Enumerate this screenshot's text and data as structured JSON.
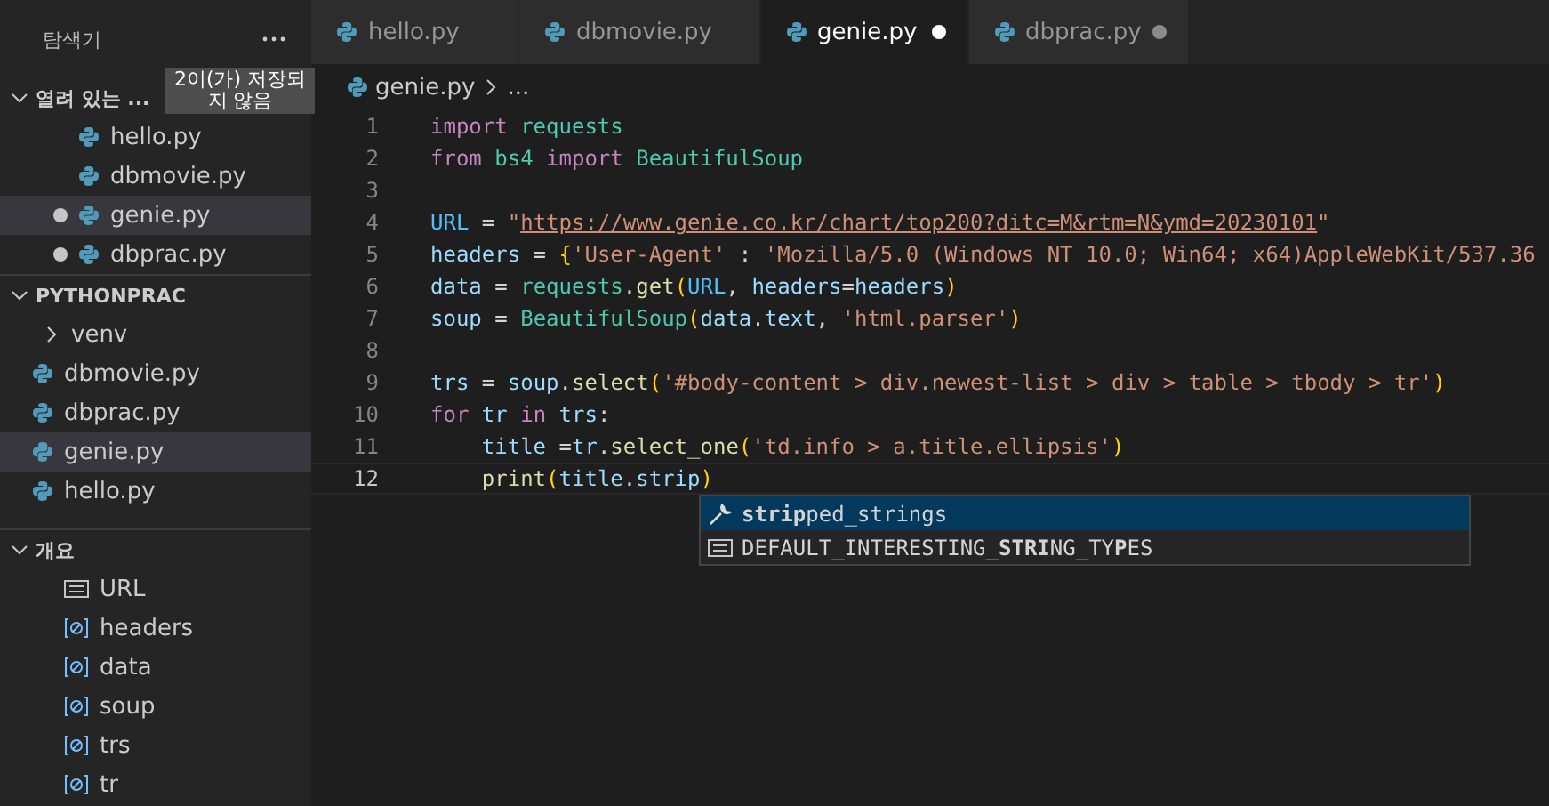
{
  "sidebar": {
    "title": "탐색기",
    "open_editors": {
      "title": "열려 있는 ...",
      "expanded": true,
      "tooltip": "2이(가) 저장되지 않음",
      "items": [
        {
          "name": "hello.py",
          "unsaved": false,
          "selected": false
        },
        {
          "name": "dbmovie.py",
          "unsaved": false,
          "selected": false
        },
        {
          "name": "genie.py",
          "unsaved": true,
          "selected": true
        },
        {
          "name": "dbprac.py",
          "unsaved": true,
          "selected": false
        }
      ]
    },
    "project": {
      "title": "PYTHONPRAC",
      "expanded": true,
      "items": [
        {
          "kind": "folder",
          "name": "venv",
          "selected": false
        },
        {
          "kind": "file",
          "name": "dbmovie.py",
          "selected": false
        },
        {
          "kind": "file",
          "name": "dbprac.py",
          "selected": false
        },
        {
          "kind": "file",
          "name": "genie.py",
          "selected": true
        },
        {
          "kind": "file",
          "name": "hello.py",
          "selected": false
        }
      ]
    },
    "outline": {
      "title": "개요",
      "expanded": true,
      "items": [
        {
          "kind": "constant",
          "name": "URL"
        },
        {
          "kind": "variable",
          "name": "headers"
        },
        {
          "kind": "variable",
          "name": "data"
        },
        {
          "kind": "variable",
          "name": "soup"
        },
        {
          "kind": "variable",
          "name": "trs"
        },
        {
          "kind": "variable",
          "name": "tr"
        }
      ]
    }
  },
  "tabs": [
    {
      "label": "hello.py",
      "selected": false,
      "unsaved": false
    },
    {
      "label": "dbmovie.py",
      "selected": false,
      "unsaved": false
    },
    {
      "label": "genie.py",
      "selected": true,
      "unsaved": true
    },
    {
      "label": "dbprac.py",
      "selected": false,
      "unsaved": true
    }
  ],
  "breadcrumb": {
    "file": "genie.py",
    "more": "..."
  },
  "code": [
    {
      "number": "1",
      "current": false,
      "tokens": [
        {
          "text": "import ",
          "kind": "keyword"
        },
        {
          "text": "requests",
          "kind": "module"
        }
      ]
    },
    {
      "number": "2",
      "current": false,
      "tokens": [
        {
          "text": "from ",
          "kind": "keyword"
        },
        {
          "text": "bs4 ",
          "kind": "module"
        },
        {
          "text": "import ",
          "kind": "keyword"
        },
        {
          "text": "BeautifulSoup",
          "kind": "module"
        }
      ]
    },
    {
      "number": "3",
      "current": false
    },
    {
      "number": "4",
      "current": false,
      "tokens": [
        {
          "text": "URL",
          "kind": "constant"
        },
        {
          "text": " = ",
          "kind": "plain"
        },
        {
          "text": "\"",
          "kind": "string"
        },
        {
          "text": "https://www.genie.co.kr/chart/top200?ditc=M&rtm=N&ymd=20230101",
          "kind": "link"
        },
        {
          "text": "\"",
          "kind": "string"
        }
      ]
    },
    {
      "number": "5",
      "current": false,
      "tokens": [
        {
          "text": "headers",
          "kind": "variable"
        },
        {
          "text": " = ",
          "kind": "plain"
        },
        {
          "text": "{",
          "kind": "bracket"
        },
        {
          "text": "'User-Agent'",
          "kind": "string"
        },
        {
          "text": " : ",
          "kind": "plain"
        },
        {
          "text": "'Mozilla/5.0 (Windows NT 10.0; Win64; x64)AppleWebKit/537.36",
          "kind": "string"
        }
      ]
    },
    {
      "number": "6",
      "current": false,
      "tokens": [
        {
          "text": "data",
          "kind": "variable"
        },
        {
          "text": " = ",
          "kind": "plain"
        },
        {
          "text": "requests",
          "kind": "module"
        },
        {
          "text": ".",
          "kind": "plain"
        },
        {
          "text": "get",
          "kind": "function"
        },
        {
          "text": "(",
          "kind": "bracket"
        },
        {
          "text": "URL",
          "kind": "constant"
        },
        {
          "text": ", ",
          "kind": "plain"
        },
        {
          "text": "headers",
          "kind": "variable"
        },
        {
          "text": "=",
          "kind": "plain"
        },
        {
          "text": "headers",
          "kind": "variable"
        },
        {
          "text": ")",
          "kind": "bracket"
        }
      ]
    },
    {
      "number": "7",
      "current": false,
      "tokens": [
        {
          "text": "soup",
          "kind": "variable"
        },
        {
          "text": " = ",
          "kind": "plain"
        },
        {
          "text": "BeautifulSoup",
          "kind": "module"
        },
        {
          "text": "(",
          "kind": "bracket"
        },
        {
          "text": "data",
          "kind": "variable"
        },
        {
          "text": ".",
          "kind": "plain"
        },
        {
          "text": "text",
          "kind": "variable"
        },
        {
          "text": ", ",
          "kind": "plain"
        },
        {
          "text": "'html.parser'",
          "kind": "string"
        },
        {
          "text": ")",
          "kind": "bracket"
        }
      ]
    },
    {
      "number": "8",
      "current": false
    },
    {
      "number": "9",
      "current": false,
      "tokens": [
        {
          "text": "trs",
          "kind": "variable"
        },
        {
          "text": " = ",
          "kind": "plain"
        },
        {
          "text": "soup",
          "kind": "variable"
        },
        {
          "text": ".",
          "kind": "plain"
        },
        {
          "text": "select",
          "kind": "function"
        },
        {
          "text": "(",
          "kind": "bracket"
        },
        {
          "text": "'#body-content > div.newest-list > div > table > tbody > tr'",
          "kind": "string"
        },
        {
          "text": ")",
          "kind": "bracket"
        }
      ]
    },
    {
      "number": "10",
      "current": false,
      "tokens": [
        {
          "text": "for ",
          "kind": "keyword"
        },
        {
          "text": "tr ",
          "kind": "variable"
        },
        {
          "text": "in ",
          "kind": "keyword"
        },
        {
          "text": "trs",
          "kind": "variable"
        },
        {
          "text": ":",
          "kind": "plain"
        }
      ]
    },
    {
      "number": "11",
      "current": false,
      "tokens": [
        {
          "text": "    title",
          "kind": "variable"
        },
        {
          "text": " =",
          "kind": "plain"
        },
        {
          "text": "tr",
          "kind": "variable"
        },
        {
          "text": ".",
          "kind": "plain"
        },
        {
          "text": "select_one",
          "kind": "function"
        },
        {
          "text": "(",
          "kind": "bracket"
        },
        {
          "text": "'td.info > a.title.ellipsis'",
          "kind": "string"
        },
        {
          "text": ")",
          "kind": "bracket"
        }
      ]
    },
    {
      "number": "12",
      "current": true,
      "tokens": [
        {
          "text": "    print",
          "kind": "function"
        },
        {
          "text": "(",
          "kind": "bracket"
        },
        {
          "text": "title",
          "kind": "variable"
        },
        {
          "text": ".",
          "kind": "plain"
        },
        {
          "text": "strip",
          "kind": "variable"
        },
        {
          "text": ")",
          "kind": "bracket"
        }
      ]
    }
  ],
  "suggestions": [
    {
      "kind": "property",
      "label": "**strip**ped_strings",
      "selected": true
    },
    {
      "kind": "constant",
      "label": "DEFAULT_INTERESTING_**STRI**NG_TY**P**ES",
      "selected": false
    }
  ]
}
